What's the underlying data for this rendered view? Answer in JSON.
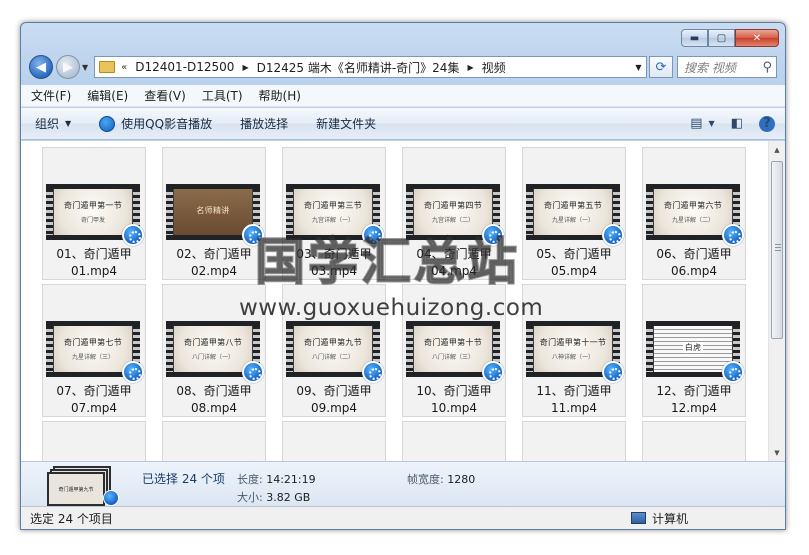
{
  "window": {
    "caption": {
      "minimize": "▬",
      "maximize": "▢",
      "close": "✕"
    }
  },
  "address": {
    "chevron": "«",
    "crumbs": [
      "D12401-D12500",
      "D12425 端木《名师精讲-奇门》24集",
      "视频"
    ]
  },
  "search": {
    "placeholder": "搜索 视频"
  },
  "menu": [
    "文件(F)",
    "编辑(E)",
    "查看(V)",
    "工具(T)",
    "帮助(H)"
  ],
  "toolbar": {
    "organize": "组织",
    "play_qq": "使用QQ影音播放",
    "play_select": "播放选择",
    "new_folder": "新建文件夹"
  },
  "files": [
    {
      "line1": "01、奇门遁甲",
      "line2": "01.mp4",
      "thumb_title": "奇门遁甲第一节",
      "thumb_sub": "奇门甲发",
      "style": "plain"
    },
    {
      "line1": "02、奇门遁甲",
      "line2": "02.mp4",
      "thumb_title": "名师精讲",
      "thumb_sub": "",
      "style": "photo"
    },
    {
      "line1": "03、奇门遁甲",
      "line2": "03.mp4",
      "thumb_title": "奇门遁甲第三节",
      "thumb_sub": "九宫详解（一）",
      "style": "plain"
    },
    {
      "line1": "04、奇门遁甲",
      "line2": "04.mp4",
      "thumb_title": "奇门遁甲第四节",
      "thumb_sub": "九宫详解（二）",
      "style": "plain"
    },
    {
      "line1": "05、奇门遁甲",
      "line2": "05.mp4",
      "thumb_title": "奇门遁甲第五节",
      "thumb_sub": "九星详解（一）",
      "style": "plain"
    },
    {
      "line1": "06、奇门遁甲",
      "line2": "06.mp4",
      "thumb_title": "奇门遁甲第六节",
      "thumb_sub": "九星详解（二）",
      "style": "plain"
    },
    {
      "line1": "07、奇门遁甲",
      "line2": "07.mp4",
      "thumb_title": "奇门遁甲第七节",
      "thumb_sub": "九星详解（三）",
      "style": "plain"
    },
    {
      "line1": "08、奇门遁甲",
      "line2": "08.mp4",
      "thumb_title": "奇门遁甲第八节",
      "thumb_sub": "八门详解（一）",
      "style": "plain"
    },
    {
      "line1": "09、奇门遁甲",
      "line2": "09.mp4",
      "thumb_title": "奇门遁甲第九节",
      "thumb_sub": "八门详解（二）",
      "style": "plain"
    },
    {
      "line1": "10、奇门遁甲",
      "line2": "10.mp4",
      "thumb_title": "奇门遁甲第十节",
      "thumb_sub": "八门详解（三）",
      "style": "plain"
    },
    {
      "line1": "11、奇门遁甲",
      "line2": "11.mp4",
      "thumb_title": "奇门遁甲第十一节",
      "thumb_sub": "八神详解（一）",
      "style": "plain"
    },
    {
      "line1": "12、奇门遁甲",
      "line2": "12.mp4",
      "thumb_title": "白虎",
      "thumb_sub": "",
      "style": "doc"
    }
  ],
  "watermark": {
    "cn": "国学汇总站",
    "url": "www.guoxuehuizong.com"
  },
  "details": {
    "selected": "已选择 24 个项",
    "length_label": "长度:",
    "length_value": "14:21:19",
    "size_label": "大小:",
    "size_value": "3.82 GB",
    "width_label": "帧宽度:",
    "width_value": "1280",
    "stack_title": "奇门遁甲第九节"
  },
  "status": {
    "left": "选定 24 个项目",
    "right": "计算机"
  },
  "colors": {
    "accent": "#2a6bbf",
    "frame": "#b9d1ec",
    "badge": "#1361c2"
  }
}
